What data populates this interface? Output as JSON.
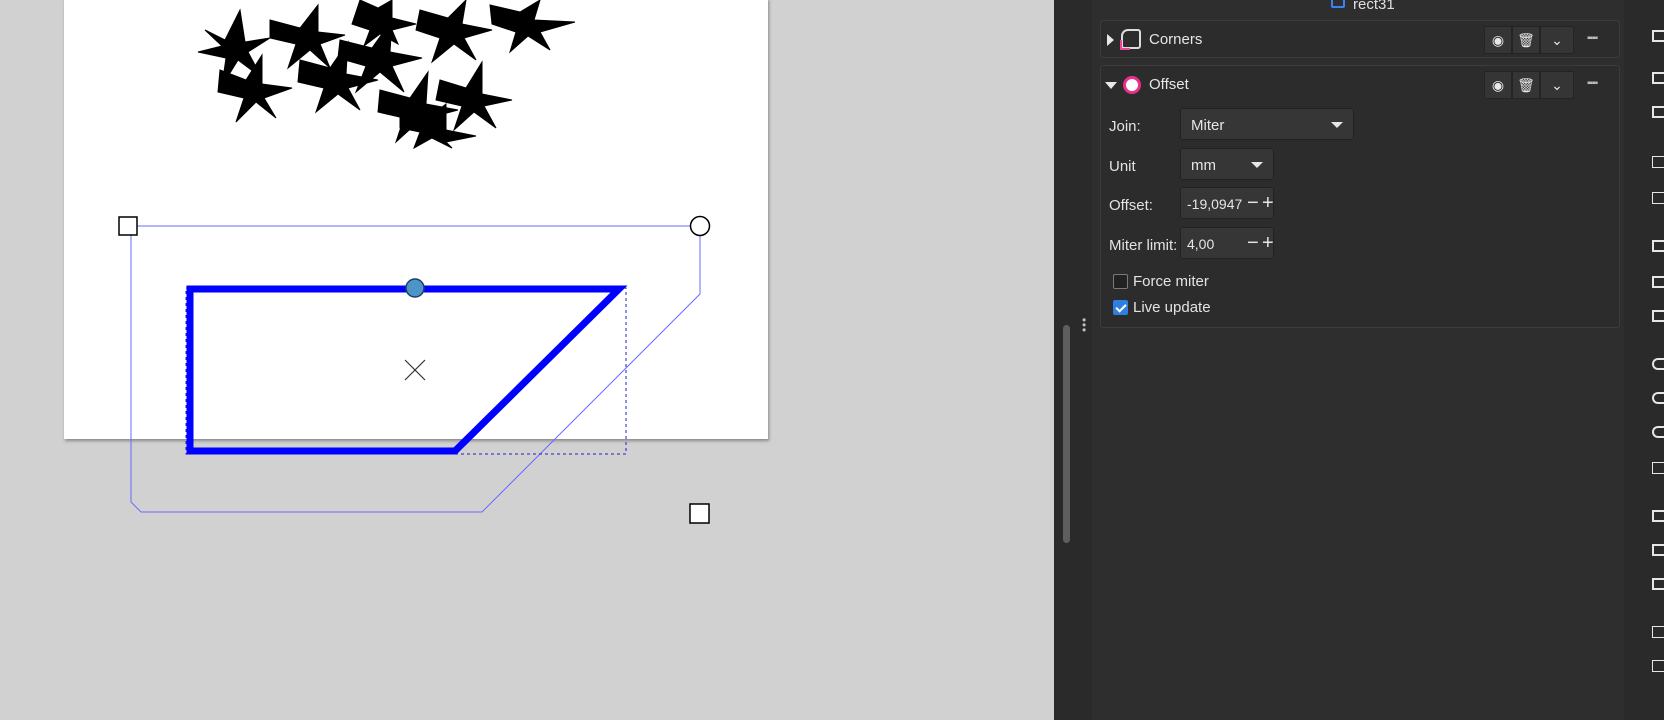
{
  "object": {
    "label": "rect31"
  },
  "effects": [
    {
      "title": "Corners",
      "expanded": false
    },
    {
      "title": "Offset",
      "expanded": true
    }
  ],
  "offset_params": {
    "join_label": "Join:",
    "join_value": "Miter",
    "unit_label": "Unit",
    "unit_value": "mm",
    "offset_label": "Offset:",
    "offset_value": "-19,0947",
    "miter_limit_label": "Miter limit:",
    "miter_limit_value": "4,00",
    "force_miter_label": "Force miter",
    "force_miter_checked": false,
    "live_update_label": "Live update",
    "live_update_checked": true
  },
  "colors": {
    "path_stroke": "#0000ff",
    "helper_outline": "#6b6bff",
    "panel_bg": "#2e2e2e",
    "canvas_bg": "#d1d1d1",
    "accent_pink": "#e8308a",
    "check_blue": "#2f7fe0"
  },
  "icons": [
    "eye-icon",
    "trash-icon",
    "chevron-down-icon",
    "grip-icon",
    "corners-effect-icon",
    "offset-effect-icon",
    "checkmark-icon"
  ]
}
